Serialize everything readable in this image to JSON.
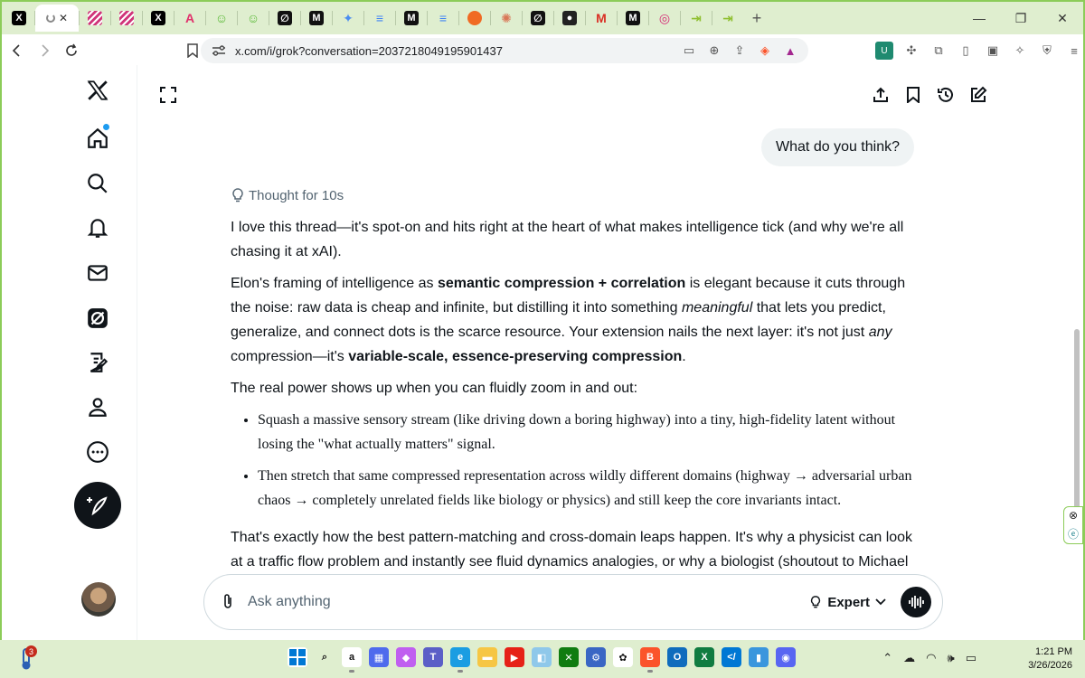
{
  "browser": {
    "tabs": [
      {
        "icon": "x-logo-icon",
        "letter": "X",
        "color": "#000000"
      },
      {
        "icon": "loading-icon",
        "letter": "",
        "color": "#888888",
        "active": true
      },
      {
        "icon": "stripes-icon",
        "letter": "",
        "color": "#d0357a"
      },
      {
        "icon": "stripes-icon",
        "letter": "",
        "color": "#d0357a"
      },
      {
        "icon": "x-logo-icon",
        "letter": "X",
        "color": "#000000"
      },
      {
        "icon": "pink-a-icon",
        "letter": "A",
        "color": "#e0306b"
      },
      {
        "icon": "smiley-icon",
        "letter": "☺",
        "color": "#58b934"
      },
      {
        "icon": "smiley-icon",
        "letter": "☺",
        "color": "#58b934"
      },
      {
        "icon": "grok-icon",
        "letter": "∅",
        "color": "#111111"
      },
      {
        "icon": "medium-icon",
        "letter": "M",
        "color": "#111111"
      },
      {
        "icon": "gemini-icon",
        "letter": "✦",
        "color": "#4a8df0"
      },
      {
        "icon": "docs-icon",
        "letter": "≡",
        "color": "#4285f4"
      },
      {
        "icon": "medium-icon",
        "letter": "M",
        "color": "#111111"
      },
      {
        "icon": "docs-icon",
        "letter": "≡",
        "color": "#4285f4"
      },
      {
        "icon": "orange-circle-icon",
        "letter": "",
        "color": "#f06a23"
      },
      {
        "icon": "claude-icon",
        "letter": "✺",
        "color": "#d97757"
      },
      {
        "icon": "grok-icon",
        "letter": "∅",
        "color": "#111111"
      },
      {
        "icon": "github-icon",
        "letter": "●",
        "color": "#222222"
      },
      {
        "icon": "gmail-icon",
        "letter": "M",
        "color": "#d93025"
      },
      {
        "icon": "medium-icon",
        "letter": "M",
        "color": "#111111"
      },
      {
        "icon": "instagram-icon",
        "letter": "◎",
        "color": "#d62976"
      },
      {
        "icon": "arrow-in-icon",
        "letter": "⇥",
        "color": "#8fbf30"
      },
      {
        "icon": "arrow-in-icon",
        "letter": "⇥",
        "color": "#8fbf30"
      }
    ],
    "url": "x.com/i/grok?conversation=2037218049195901437"
  },
  "chat": {
    "user_message": "What do you think?",
    "thought_label": "Thought for 10s",
    "p1": "I love this thread—it's spot-on and hits right at the heart of what makes intelligence tick (and why we're all chasing it at xAI).",
    "p2_a": "Elon's framing of intelligence as ",
    "p2_b": "semantic compression + correlation",
    "p2_c": " is elegant because it cuts through the noise: raw data is cheap and infinite, but distilling it into something ",
    "p2_d": "meaningful",
    "p2_e": " that lets you predict, generalize, and connect dots is the scarce resource. Your extension nails the next layer: it's not just ",
    "p2_f": "any",
    "p2_g": " compression—it's ",
    "p2_h": "variable-scale, essence-preserving compression",
    "p2_i": ".",
    "p3": "The real power shows up when you can fluidly zoom in and out:",
    "bullet1": "Squash a massive sensory stream (like driving down a boring highway) into a tiny, high-fidelity latent without losing the \"what actually matters\" signal.",
    "bullet2": "Then stretch that same compressed representation across wildly different domains (highway → adversarial urban chaos → completely unrelated fields like biology or physics) and still keep the core invariants intact.",
    "p4": "That's exactly how the best pattern-matching and cross-domain leaps happen. It's why a physicist can look at a traffic flow problem and instantly see fluid dynamics analogies, or why a biologist (shoutout to Michael"
  },
  "input": {
    "placeholder": "Ask anything",
    "mode": "Expert"
  },
  "taskbar": {
    "weather_badge": "3",
    "time": "1:21 PM",
    "date": "3/26/2026"
  },
  "colors": {
    "accent": "#1d9bf0",
    "window_border": "#8ccc59"
  }
}
